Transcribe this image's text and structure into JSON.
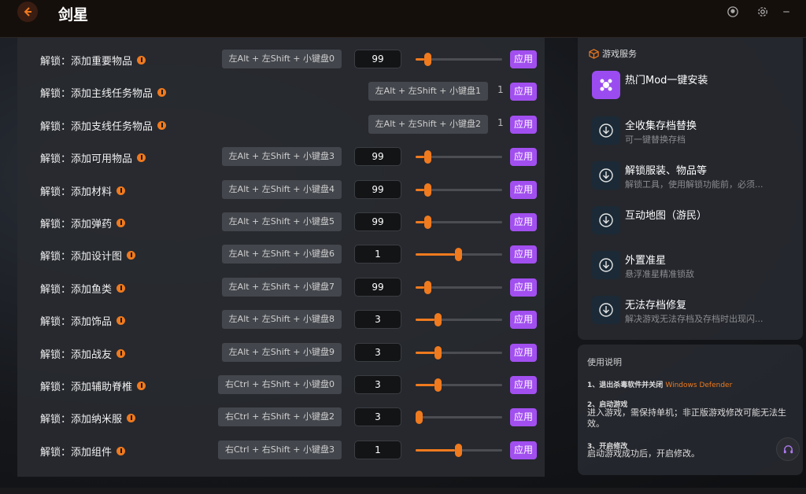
{
  "app": {
    "title": "剑星"
  },
  "rows": [
    {
      "label": "解锁：添加重要物品",
      "hotkey": "左Alt + 左Shift + 小键盘0",
      "value": "99",
      "level": 0.1
    },
    {
      "label": "解锁：添加主线任务物品",
      "hotkey": "左Alt + 左Shift + 小键盘1",
      "plain_value": "1"
    },
    {
      "label": "解锁：添加支线任务物品",
      "hotkey": "左Alt + 左Shift + 小键盘2",
      "plain_value": "1"
    },
    {
      "label": "解锁：添加可用物品",
      "hotkey": "左Alt + 左Shift + 小键盘3",
      "value": "99",
      "level": 0.1
    },
    {
      "label": "解锁：添加材料",
      "hotkey": "左Alt + 左Shift + 小键盘4",
      "value": "99",
      "level": 0.1
    },
    {
      "label": "解锁：添加弹药",
      "hotkey": "左Alt + 左Shift + 小键盘5",
      "value": "99",
      "level": 0.1
    },
    {
      "label": "解锁：添加设计图",
      "hotkey": "左Alt + 左Shift + 小键盘6",
      "value": "1",
      "level": 0.45
    },
    {
      "label": "解锁：添加鱼类",
      "hotkey": "左Alt + 左Shift + 小键盘7",
      "value": "99",
      "level": 0.1
    },
    {
      "label": "解锁：添加饰品",
      "hotkey": "左Alt + 左Shift + 小键盘8",
      "value": "3",
      "level": 0.22
    },
    {
      "label": "解锁：添加战友",
      "hotkey": "左Alt + 左Shift + 小键盘9",
      "value": "3",
      "level": 0.22
    },
    {
      "label": "解锁：添加辅助脊椎",
      "hotkey": "右Ctrl + 右Shift + 小键盘0",
      "value": "3",
      "level": 0.22
    },
    {
      "label": "解锁：添加纳米服",
      "hotkey": "右Ctrl + 右Shift + 小键盘2",
      "value": "3",
      "level": 0.0
    },
    {
      "label": "解锁：添加组件",
      "hotkey": "右Ctrl + 右Shift + 小键盘3",
      "value": "1",
      "level": 0.45
    }
  ],
  "apply_label": "应用",
  "services": {
    "heading": "游戏服务",
    "items": [
      {
        "title": "热门Mod一键安装",
        "desc": "",
        "icon": "mod-icon"
      },
      {
        "title": "全收集存档替换",
        "desc": "可一键替换存档",
        "icon": "download-icon"
      },
      {
        "title": "解锁服装、物品等",
        "desc": "解锁工具，使用解锁功能前，必须...",
        "icon": "download-icon"
      },
      {
        "title": "互动地图（游民）",
        "desc": "",
        "icon": "download-icon"
      },
      {
        "title": "外置准星",
        "desc": "悬浮准星精准锁敌",
        "icon": "download-icon"
      },
      {
        "title": "无法存档修复",
        "desc": "解决游戏无法存档及存档时出现闪...",
        "icon": "download-icon"
      }
    ]
  },
  "notes": {
    "title": "使用说明",
    "step1": "1、退出杀毒软件并关闭",
    "step1_highlight": "Windows Defender",
    "step2": "2、启动游戏",
    "step2_text": "进入游戏，需保持单机；非正版游戏修改可能无法生效。",
    "step3": "3、开启修改",
    "step3_text": "启动游戏成功后，开启修改。"
  },
  "colors": {
    "accent": "#a24ff0",
    "orange": "#f07a1e"
  }
}
